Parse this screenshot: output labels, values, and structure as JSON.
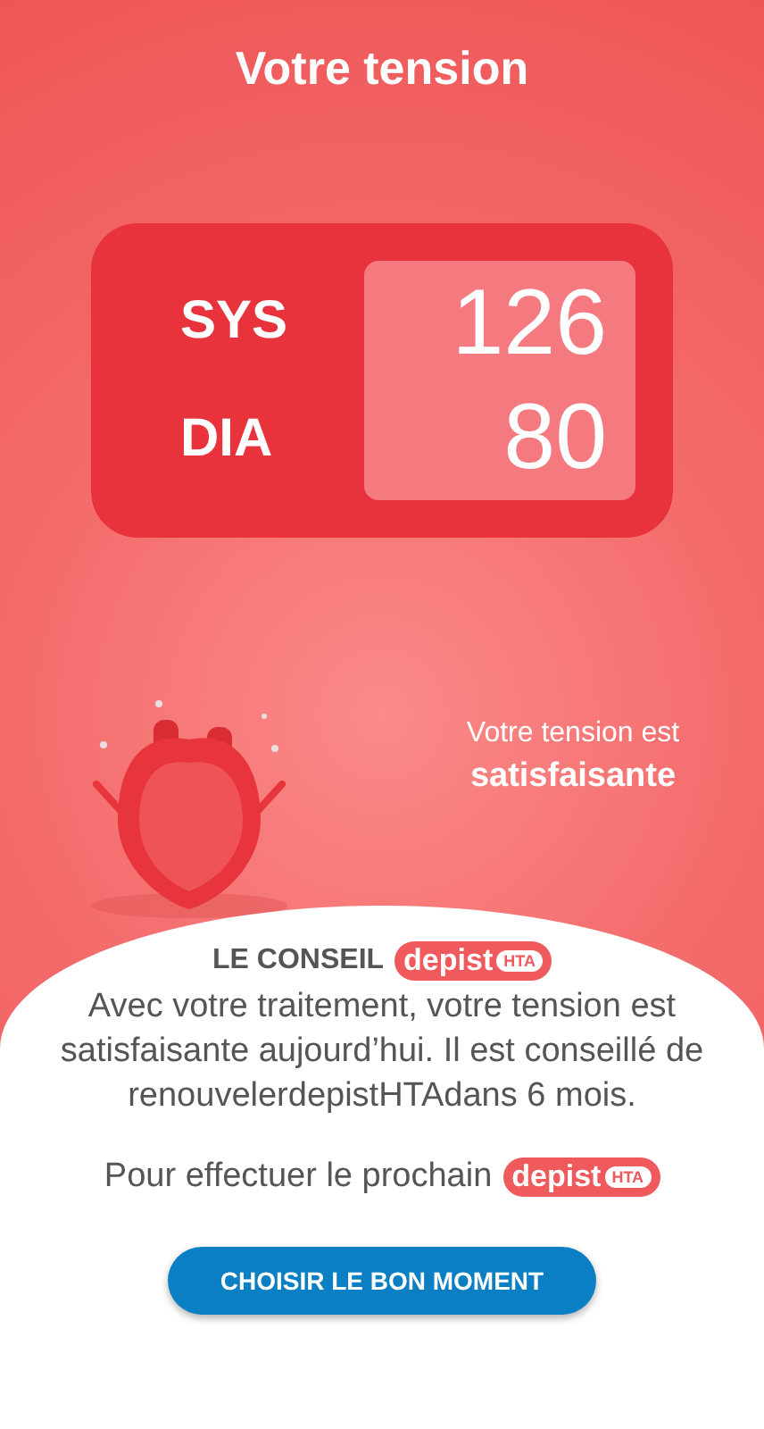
{
  "title": "Votre tension",
  "readings": [
    {
      "label": "SYS",
      "value": "126"
    },
    {
      "label": "DIA",
      "value": "80"
    }
  ],
  "status": {
    "line": "Votre tension est",
    "verdict": "satisfaisante"
  },
  "advice": {
    "heading": "LE CONSEIL",
    "logo": {
      "word": "depist",
      "tag": "HTA"
    },
    "text": "Avec votre traitement, votre tension est satisfaisante aujourd’hui. Il est conseillé de renouvelerdepistHTAdans 6 mois.",
    "next": "Pour effectuer le prochain",
    "next_logo": {
      "word": "depist",
      "tag": "HTA"
    },
    "button": "CHOISIR LE BON MOMENT"
  }
}
